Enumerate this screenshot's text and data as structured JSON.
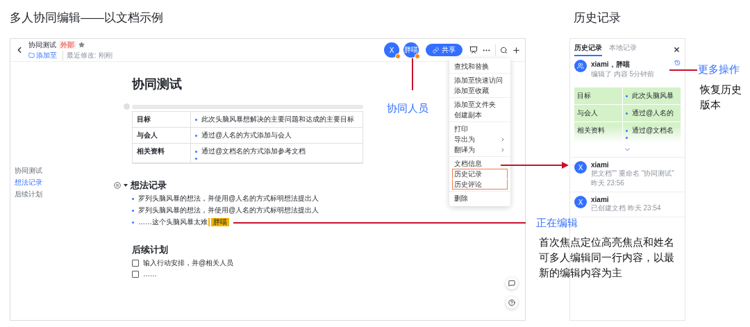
{
  "heading": "多人协同编辑——以文档示例",
  "doc_window": {
    "topbar": {
      "title": "协同测试",
      "badge": "外部",
      "folder_link": "添加至",
      "modified": "最近修改: 刚刚",
      "collaborators": [
        {
          "label": "X"
        },
        {
          "label": "胖喵"
        }
      ],
      "share_button": "共享"
    },
    "outline": [
      {
        "label": "协同测试",
        "selected": false
      },
      {
        "label": "想法记录",
        "selected": true
      },
      {
        "label": "后续计划",
        "selected": false
      }
    ],
    "doc": {
      "title": "协同测试",
      "table": [
        {
          "label": "目标",
          "bullets": [
            "此次头脑风暴想解决的主要问题和达成的主要目标"
          ],
          "trailing_empty_bullet": false
        },
        {
          "label": "与会人",
          "bullets": [
            "通过@人名的方式添加与会人"
          ],
          "trailing_empty_bullet": false
        },
        {
          "label": "相关资料",
          "bullets": [
            "通过@文档名的方式添加参考文档"
          ],
          "trailing_empty_bullet": true
        }
      ],
      "sections": [
        {
          "heading": "想法记录",
          "kind": "bullets",
          "show_toggle": true,
          "items": [
            {
              "text": "罗列头脑风暴的想法，并使用@人名的方式标明想法提出人"
            },
            {
              "text": "罗列头脑风暴的想法，并使用@人名的方式标明想法提出人"
            },
            {
              "text": "……这个头脑风暴太难",
              "cursor": "胖喵"
            }
          ]
        },
        {
          "heading": "后续计划",
          "kind": "checklist",
          "show_toggle": false,
          "items": [
            {
              "text": "输入行动安排，并@相关人员",
              "checked": false
            },
            {
              "text": "……",
              "checked": false
            }
          ]
        }
      ]
    },
    "menu": [
      [
        {
          "label": "查找和替换",
          "submenu": false,
          "highlighted": false
        }
      ],
      [
        {
          "label": "添加至快速访问",
          "submenu": false,
          "highlighted": false
        },
        {
          "label": "添加至收藏",
          "submenu": false,
          "highlighted": false
        }
      ],
      [
        {
          "label": "添加至文件夹",
          "submenu": false,
          "highlighted": false
        },
        {
          "label": "创建副本",
          "submenu": false,
          "highlighted": false
        }
      ],
      [
        {
          "label": "打印",
          "submenu": false,
          "highlighted": false
        },
        {
          "label": "导出为",
          "submenu": true,
          "highlighted": false
        },
        {
          "label": "翻译为",
          "submenu": true,
          "highlighted": false
        }
      ],
      [
        {
          "label": "文档信息",
          "submenu": false,
          "highlighted": false
        },
        {
          "label": "历史记录",
          "submenu": false,
          "highlighted": true
        },
        {
          "label": "历史评论",
          "submenu": false,
          "highlighted": true
        }
      ],
      [
        {
          "label": "删除",
          "submenu": false,
          "highlighted": false
        }
      ]
    ]
  },
  "history_panel": {
    "title": "历史记录",
    "tabs": [
      {
        "label": "历史记录",
        "selected": true
      },
      {
        "label": "本地记录",
        "selected": false
      }
    ],
    "entries": [
      {
        "kind": "group",
        "name": "xiami，胖喵",
        "action": "编辑了 内容",
        "time": "5分钟前",
        "expanded": true,
        "preview": [
          {
            "label": "目标",
            "text": "此次头脑风暴",
            "trailing_empty_bullet": false
          },
          {
            "label": "与会人",
            "text": "通过@人名的",
            "trailing_empty_bullet": false
          },
          {
            "label": "相关资料",
            "text": "通过@文档名",
            "trailing_empty_bullet": true
          }
        ]
      },
      {
        "kind": "letter",
        "avatar": "X",
        "name": "xiami",
        "action": "把文档\"\" 重命名 \"协同测试\"",
        "time": "昨天 23:56",
        "expanded": false
      },
      {
        "kind": "letter",
        "avatar": "X",
        "name": "xiami",
        "action": "已创建文档",
        "time": "昨天 23:54",
        "expanded": false
      }
    ]
  },
  "annotations": {
    "collaborators": "协同人员",
    "editing": "正在编辑",
    "editing_detail": "首次焦点定位高亮焦点和姓名可多人编辑同一行内容，以最新的编辑内容为主",
    "more_actions": "更多操作",
    "restore": "恢复历史版本"
  }
}
